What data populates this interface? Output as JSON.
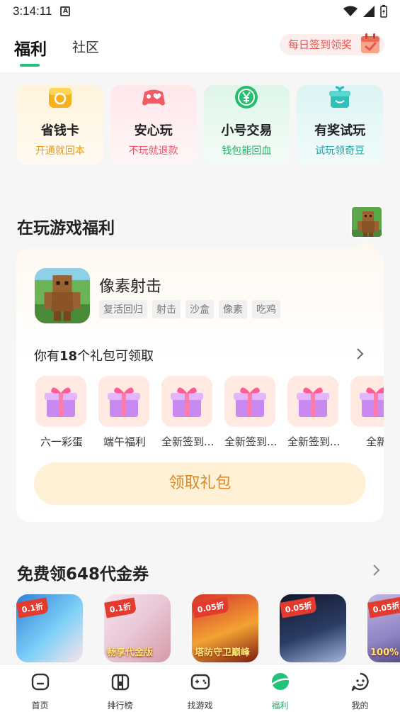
{
  "status_bar": {
    "time": "3:14:11",
    "app_badge": "A"
  },
  "header": {
    "tabs": [
      {
        "label": "福利",
        "active": true
      },
      {
        "label": "社区",
        "active": false
      }
    ],
    "daily_signin": "每日签到领奖"
  },
  "features": [
    {
      "title": "省钱卡",
      "subtitle": "开通就回本",
      "icon": "coin-card-icon"
    },
    {
      "title": "安心玩",
      "subtitle": "不玩就退款",
      "icon": "gamepad-heart-icon"
    },
    {
      "title": "小号交易",
      "subtitle": "钱包能回血",
      "icon": "yen-coin-icon"
    },
    {
      "title": "有奖试玩",
      "subtitle": "试玩领奇豆",
      "icon": "gift-box-icon"
    }
  ],
  "playing_section": {
    "title": "在玩游戏福利",
    "game": {
      "name": "像素射击",
      "tags": [
        "复活回归",
        "射击",
        "沙盒",
        "像素",
        "吃鸡"
      ]
    },
    "gift_count_prefix": "你有",
    "gift_count": "18",
    "gift_count_suffix": "个礼包可领取",
    "gifts": [
      "六一彩蛋",
      "端午福利",
      "全新签到...",
      "全新签到...",
      "全新签到...",
      "全新"
    ],
    "claim_button": "领取礼包"
  },
  "voucher_section": {
    "title": "免费领648代金券",
    "items": [
      {
        "badge": "0.1折",
        "caption": ""
      },
      {
        "badge": "0.1折",
        "caption": "畅享代金版"
      },
      {
        "badge": "0.05折",
        "caption": "塔防守卫巅峰"
      },
      {
        "badge": "0.05折",
        "caption": ""
      },
      {
        "badge": "0.05折",
        "caption": "100%"
      }
    ]
  },
  "bottom_nav": [
    {
      "label": "首页",
      "icon": "home-icon",
      "active": false
    },
    {
      "label": "排行榜",
      "icon": "ranking-icon",
      "active": false
    },
    {
      "label": "找游戏",
      "icon": "gamepad-icon",
      "active": false
    },
    {
      "label": "福利",
      "icon": "planet-icon",
      "active": true
    },
    {
      "label": "我的",
      "icon": "profile-face-icon",
      "active": false
    }
  ],
  "colors": {
    "accent": "#22c27a",
    "signin": "#e8544f",
    "claim_text": "#d98a2b"
  }
}
